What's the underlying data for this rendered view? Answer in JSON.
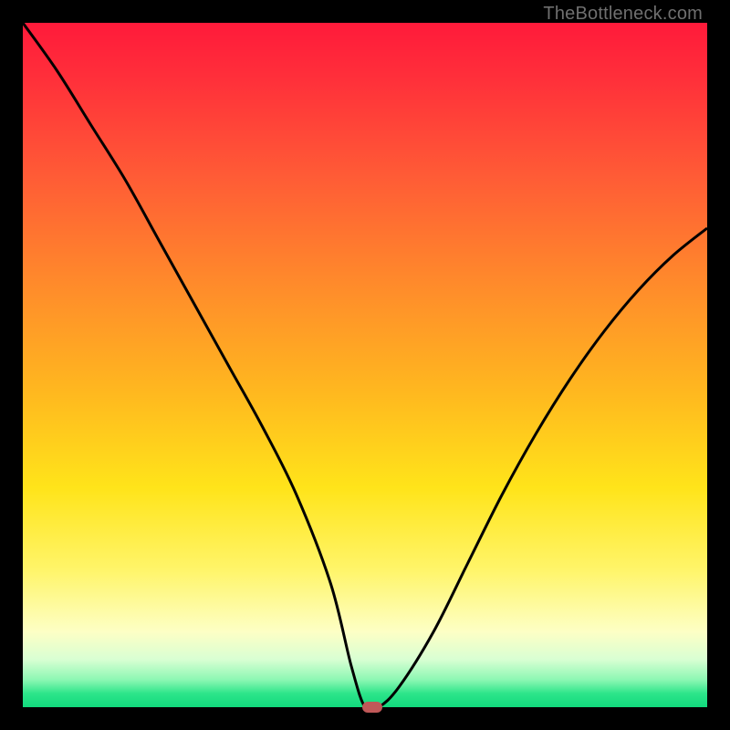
{
  "watermark": "TheBottleneck.com",
  "colors": {
    "curve": "#000000",
    "marker": "#c05858"
  },
  "chart_data": {
    "type": "line",
    "title": "",
    "xlabel": "",
    "ylabel": "",
    "xlim": [
      0,
      100
    ],
    "ylim": [
      0,
      100
    ],
    "grid": false,
    "legend": false,
    "series": [
      {
        "name": "bottleneck-curve",
        "x": [
          0,
          5,
          10,
          15,
          20,
          25,
          30,
          35,
          40,
          45,
          48,
          50,
          52,
          55,
          60,
          65,
          70,
          75,
          80,
          85,
          90,
          95,
          100
        ],
        "y": [
          100,
          93,
          85,
          77,
          68,
          59,
          50,
          41,
          31,
          18,
          6,
          0,
          0,
          3,
          11,
          21,
          31,
          40,
          48,
          55,
          61,
          66,
          70
        ]
      }
    ],
    "marker": {
      "x": 51,
      "y": 0
    }
  }
}
